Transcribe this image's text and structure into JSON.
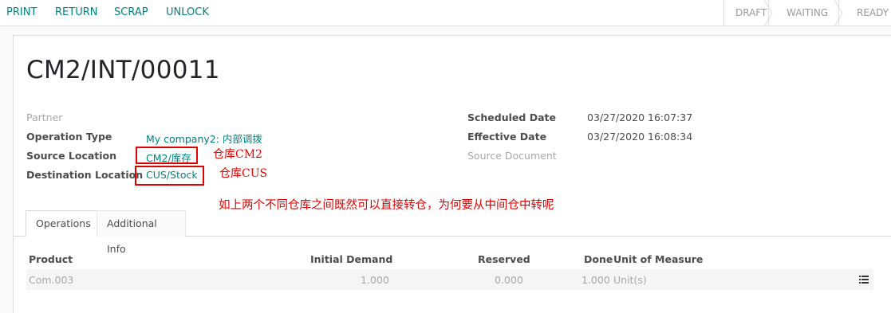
{
  "toolbar": {
    "print": "PRINT",
    "return": "RETURN",
    "scrap": "SCRAP",
    "unlock": "UNLOCK"
  },
  "status": {
    "draft": "DRAFT",
    "waiting": "WAITING",
    "ready": "READY"
  },
  "record": {
    "title": "CM2/INT/00011"
  },
  "fields": {
    "partner_label": "Partner",
    "operation_type_label": "Operation Type",
    "operation_type_value": "My company2: 内部调拨",
    "source_location_label": "Source Location",
    "source_location_value": "CM2/库存",
    "destination_location_label": "Destination Location",
    "destination_location_value": "CUS/Stock",
    "scheduled_date_label": "Scheduled Date",
    "scheduled_date_value": "03/27/2020 16:07:37",
    "effective_date_label": "Effective Date",
    "effective_date_value": "03/27/2020 16:08:34",
    "source_document_label": "Source Document"
  },
  "annotations": {
    "source_note": "仓库CM2",
    "dest_note": "仓库CUS",
    "question": "如上两个不同仓库之间既然可以直接转仓，为何要从中间仓中转呢"
  },
  "tabs": [
    {
      "label": "Operations",
      "active": true
    },
    {
      "label": "Additional Info",
      "active": false
    }
  ],
  "table": {
    "headers": {
      "product": "Product",
      "initial_demand": "Initial Demand",
      "reserved": "Reserved",
      "done": "Done",
      "uom": "Unit of Measure"
    },
    "rows": [
      {
        "product": "Com.003",
        "initial_demand": "1.000",
        "reserved": "0.000",
        "done": "1.000",
        "uom": "Unit(s)"
      }
    ]
  },
  "colors": {
    "accent": "#00827f",
    "annotation": "#e20000"
  }
}
